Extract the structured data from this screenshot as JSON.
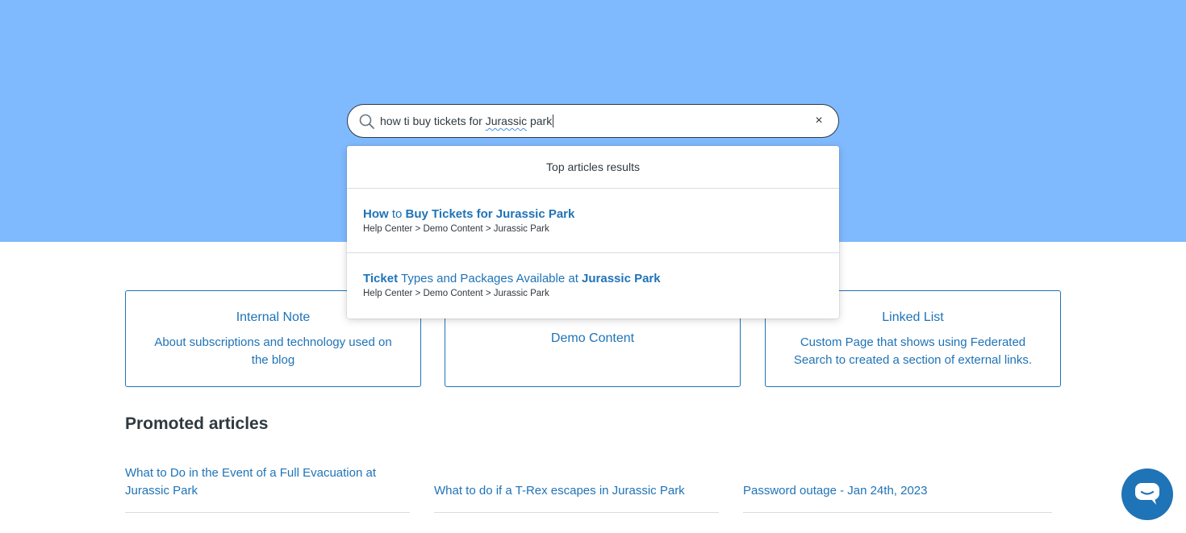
{
  "colors": {
    "hero_background": "#80bafe",
    "link": "#1f73b7",
    "text": "#2f3941",
    "chat_button": "#1f73b7"
  },
  "search": {
    "query_before": "how ti buy tickets for ",
    "query_misspelled": "Jurassic",
    "query_after": " park",
    "search_icon": "search-icon",
    "clear_icon": "close-icon",
    "clear_label": "×"
  },
  "dropdown": {
    "header": "Top articles results",
    "results": [
      {
        "title_parts": [
          {
            "text": "How",
            "bold": true
          },
          {
            "text": " to ",
            "bold": false
          },
          {
            "text": "Buy Tickets for Jurassic Park",
            "bold": true
          }
        ],
        "breadcrumb": "Help Center > Demo Content > Jurassic Park"
      },
      {
        "title_parts": [
          {
            "text": "Ticket",
            "bold": true
          },
          {
            "text": " Types and Packages Available at ",
            "bold": false
          },
          {
            "text": "Jurassic Park",
            "bold": true
          }
        ],
        "breadcrumb": "Help Center > Demo Content > Jurassic Park"
      }
    ]
  },
  "categories": [
    {
      "title": "Internal Note",
      "description": "About subscriptions and technology used on the blog"
    },
    {
      "title": "Demo Content",
      "description": ""
    },
    {
      "title": "Linked List",
      "description": "Custom Page that shows using Federated Search to created a section of external links."
    }
  ],
  "promoted": {
    "heading": "Promoted articles",
    "articles": [
      "What to Do in the Event of a Full Evacuation at Jurassic Park",
      "What to do if a T-Rex escapes in Jurassic Park",
      "Password outage - Jan 24th, 2023"
    ]
  },
  "chat": {
    "icon": "chat-bubble-icon"
  }
}
